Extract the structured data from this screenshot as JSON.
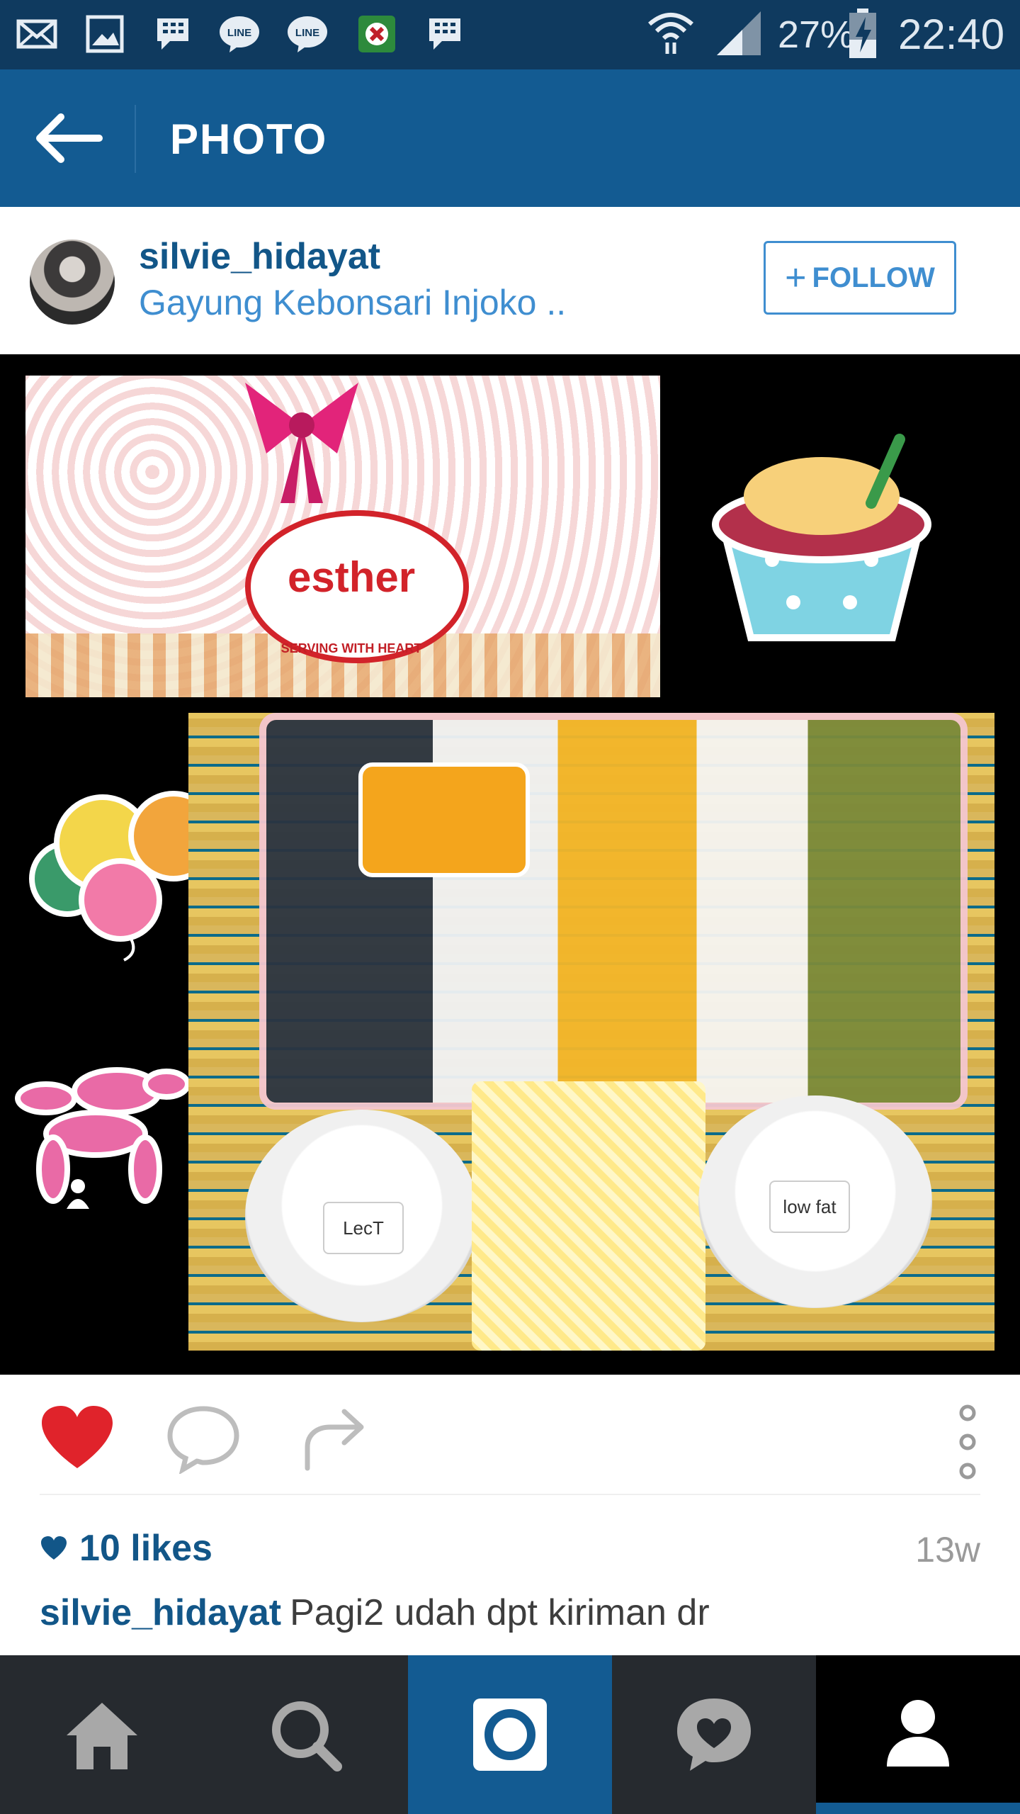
{
  "status_bar": {
    "battery": "27%",
    "time": "22:40",
    "icons": [
      "mail-icon",
      "gallery-icon",
      "bbm-icon",
      "line-icon",
      "line-icon",
      "flag-app-icon",
      "bbm-icon",
      "wifi-icon",
      "signal-icon",
      "battery-charging-icon"
    ]
  },
  "app_bar": {
    "title": "PHOTO"
  },
  "post": {
    "username": "silvie_hidayat",
    "location": "Gayung Kebonsari Injoko ..",
    "follow_label": "FOLLOW",
    "follow_plus": "+"
  },
  "photo": {
    "logo_text": "esther",
    "logo_tagline": "SERVING WITH HEART",
    "cup_label_left": "LecT",
    "cup_label_right": "low fat"
  },
  "actions": {
    "likes": "10 likes",
    "time_ago": "13w",
    "caption_user": "silvie_hidayat",
    "caption_text": "Pagi2 udah dpt kiriman dr"
  },
  "bottom_nav": {
    "items": [
      "home-icon",
      "search-icon",
      "camera-icon",
      "activity-icon",
      "profile-icon"
    ],
    "active": "profile-icon"
  },
  "colors": {
    "primary": "#135b92",
    "link": "#3f8ed0",
    "heart": "#e0232b"
  }
}
